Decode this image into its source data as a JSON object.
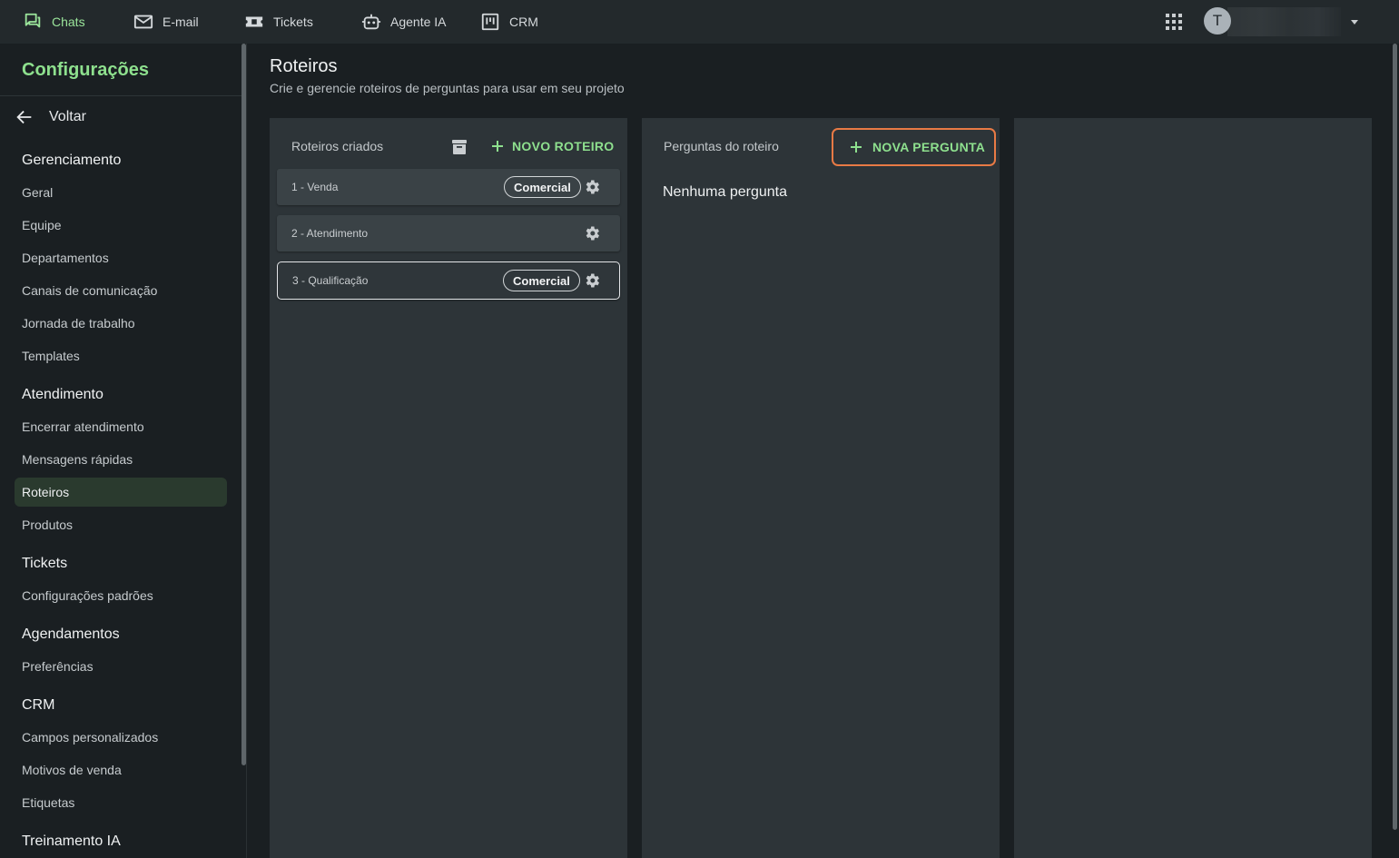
{
  "topnav": {
    "items": [
      {
        "label": "Chats",
        "icon": "chat-icon"
      },
      {
        "label": "E-mail",
        "icon": "mail-icon"
      },
      {
        "label": "Tickets",
        "icon": "ticket-icon"
      },
      {
        "label": "Agente IA",
        "icon": "robot-icon"
      },
      {
        "label": "CRM",
        "icon": "kanban-icon"
      }
    ],
    "avatar_initial": "T"
  },
  "sidebar": {
    "title": "Configurações",
    "back_label": "Voltar",
    "sections": [
      {
        "title": "Gerenciamento",
        "items": [
          "Geral",
          "Equipe",
          "Departamentos",
          "Canais de comunicação",
          "Jornada de trabalho",
          "Templates"
        ]
      },
      {
        "title": "Atendimento",
        "items": [
          "Encerrar atendimento",
          "Mensagens rápidas",
          "Roteiros",
          "Produtos"
        ]
      },
      {
        "title": "Tickets",
        "items": [
          "Configurações padrões"
        ]
      },
      {
        "title": "Agendamentos",
        "items": [
          "Preferências"
        ]
      },
      {
        "title": "CRM",
        "items": [
          "Campos personalizados",
          "Motivos de venda",
          "Etiquetas"
        ]
      },
      {
        "title": "Treinamento IA",
        "items": []
      }
    ],
    "active_item": "Roteiros"
  },
  "main": {
    "title": "Roteiros",
    "subtitle": "Crie e gerencie roteiros de perguntas para usar em seu projeto",
    "scripts_panel": {
      "heading": "Roteiros criados",
      "new_button": "NOVO ROTEIRO",
      "scripts": [
        {
          "label": "1 - Venda",
          "tag": "Comercial"
        },
        {
          "label": "2 - Atendimento",
          "tag": ""
        },
        {
          "label": "3 - Qualificação",
          "tag": "Comercial",
          "selected": true
        }
      ]
    },
    "questions_panel": {
      "heading": "Perguntas do roteiro",
      "new_button": "NOVA PERGUNTA",
      "empty_text": "Nenhuma pergunta"
    }
  },
  "colors": {
    "accent": "#8ee08e",
    "highlight": "#e87a45",
    "panel": "#2d3438",
    "background": "#1a1f22"
  }
}
